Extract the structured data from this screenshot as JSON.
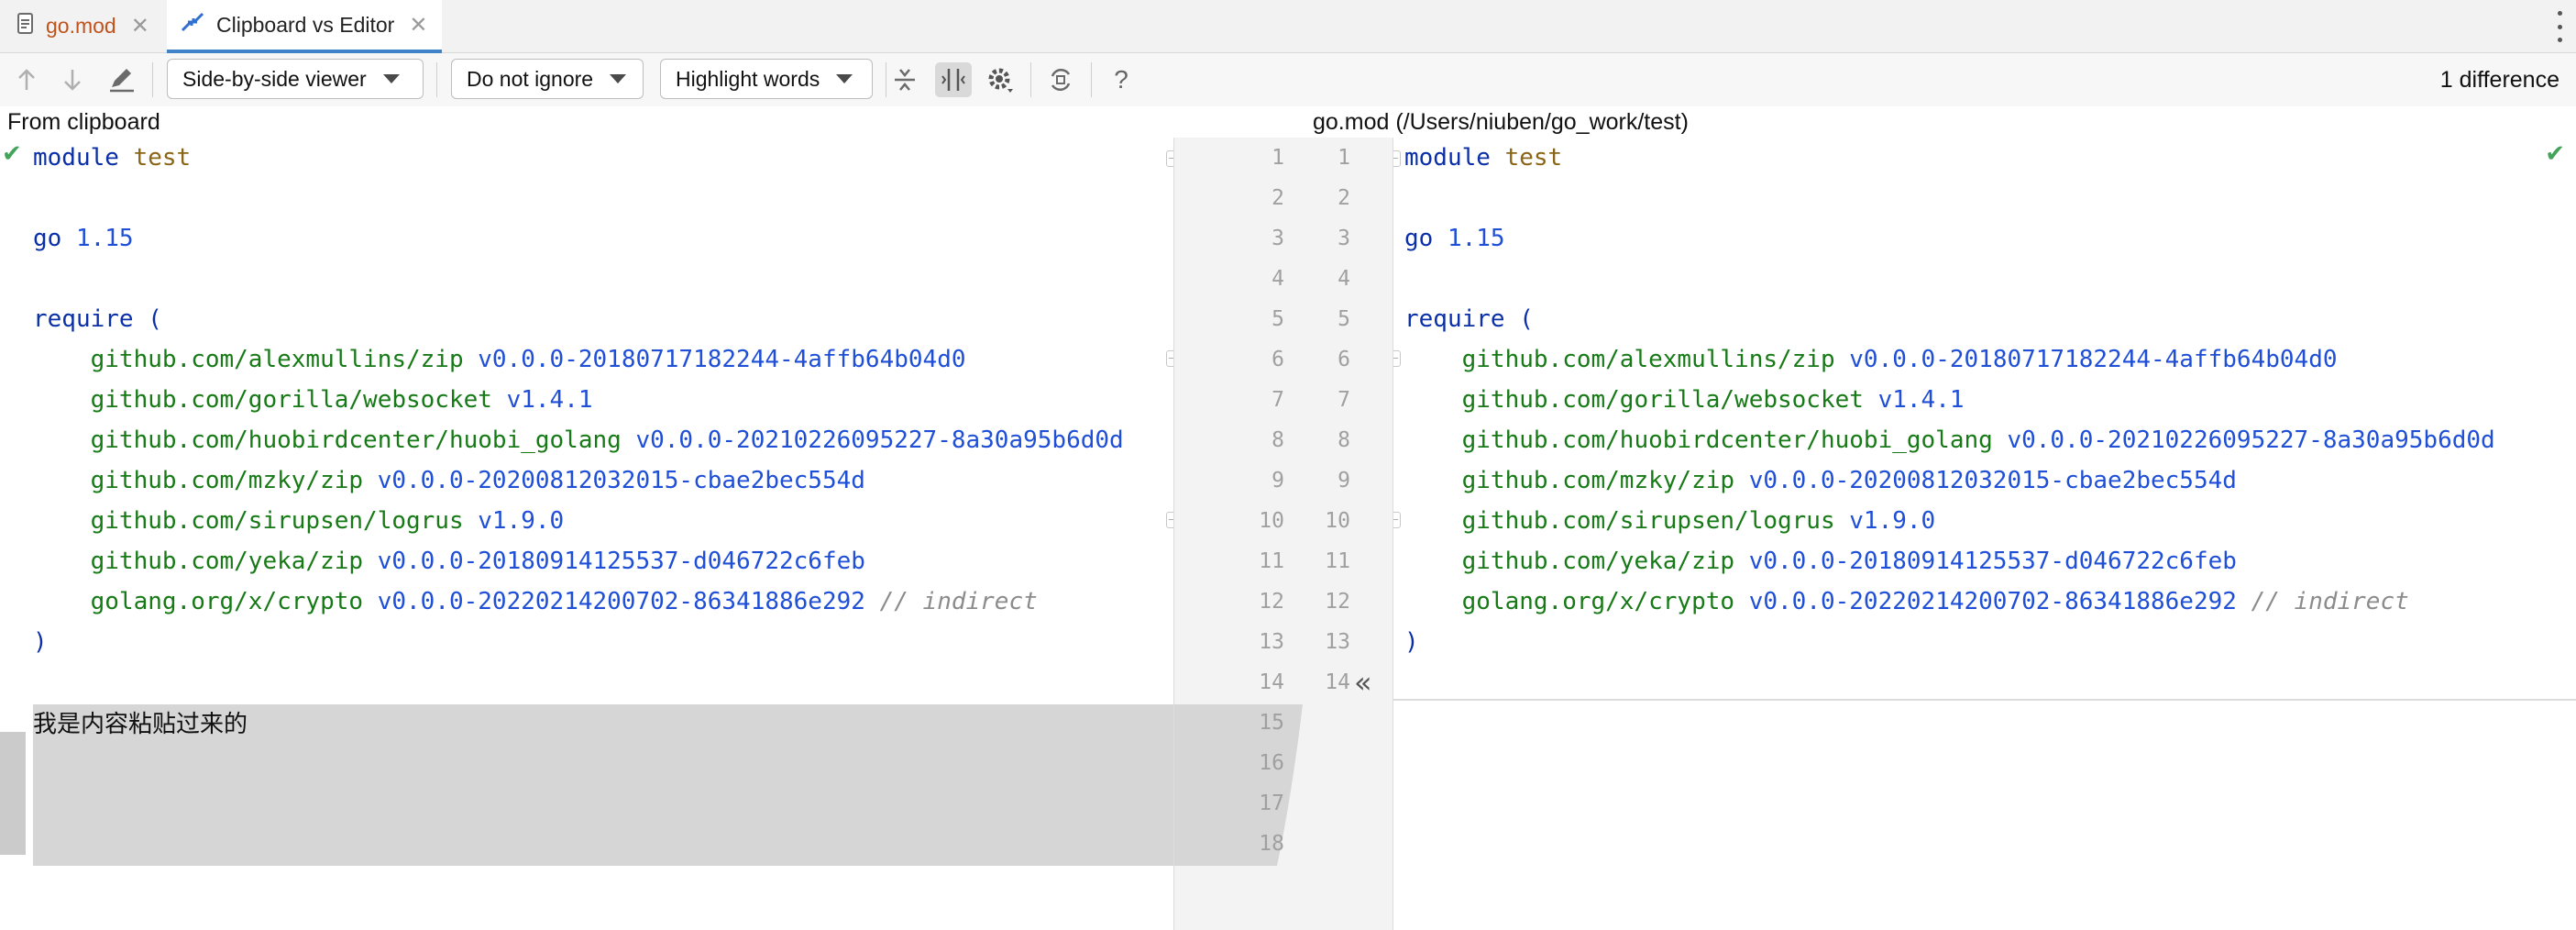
{
  "tabs": [
    {
      "label": "go.mod",
      "icon": "file-text-icon"
    },
    {
      "label": "Clipboard vs Editor",
      "icon": "diff-arrows-icon"
    }
  ],
  "toolbar": {
    "viewer": "Side-by-side viewer",
    "ignore": "Do not ignore",
    "highlight": "Highlight words",
    "difference_count": "1 difference",
    "help": "?"
  },
  "panels": {
    "left_title": "From clipboard",
    "right_title": "go.mod (/Users/niuben/go_work/test)"
  },
  "code": {
    "module_kw": "module",
    "module_name": "test",
    "go_kw": "go",
    "go_version": "1.15",
    "require_open": "require (",
    "require_close": ")",
    "requires": [
      {
        "pkg": "github.com/alexmullins/zip",
        "ver": "v0.0.0-20180717182244-4affb64b04d0",
        "comment": ""
      },
      {
        "pkg": "github.com/gorilla/websocket",
        "ver": "v1.4.1",
        "comment": ""
      },
      {
        "pkg": "github.com/huobirdcenter/huobi_golang",
        "ver": "v0.0.0-20210226095227-8a30a95b6d0d",
        "comment": ""
      },
      {
        "pkg": "github.com/mzky/zip",
        "ver": "v0.0.0-20200812032015-cbae2bec554d",
        "comment": ""
      },
      {
        "pkg": "github.com/sirupsen/logrus",
        "ver": "v1.9.0",
        "comment": ""
      },
      {
        "pkg": "github.com/yeka/zip",
        "ver": "v0.0.0-20180914125537-d046722c6feb",
        "comment": ""
      },
      {
        "pkg": "golang.org/x/crypto",
        "ver": "v0.0.0-20220214200702-86341886e292",
        "comment": "// indirect"
      }
    ],
    "inserted_text": "我是内容粘贴过来的"
  },
  "line_numbers": {
    "left": [
      "1",
      "2",
      "3",
      "4",
      "5",
      "6",
      "7",
      "8",
      "9",
      "10",
      "11",
      "12",
      "13",
      "14",
      "15",
      "16",
      "17",
      "18"
    ],
    "right": [
      "1",
      "2",
      "3",
      "4",
      "5",
      "6",
      "7",
      "8",
      "9",
      "10",
      "11",
      "12",
      "13",
      "14"
    ]
  },
  "gutter": {
    "apply_left": "«",
    "apply_right": "»"
  },
  "colors": {
    "keyword": "#0b2fa8",
    "module_name": "#8a6516",
    "version": "#1f4fd6",
    "package": "#177a17",
    "comment": "#8c8c8c",
    "inserted_block": "#d6d6d6",
    "tab_active_underline": "#4083c9"
  }
}
